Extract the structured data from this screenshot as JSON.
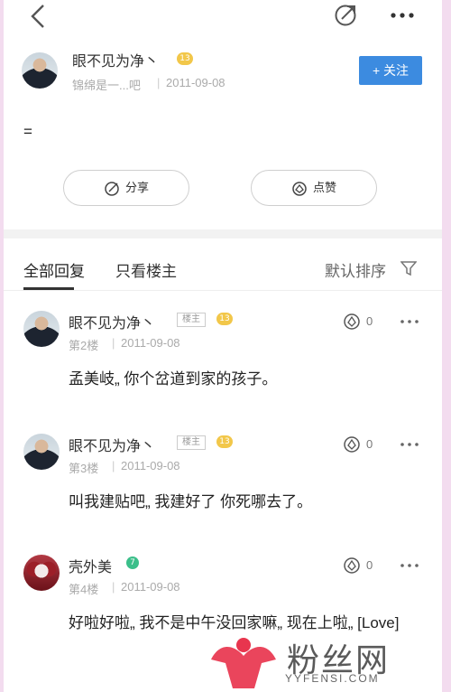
{
  "post": {
    "author": "眼不见为净丶",
    "badge_level": "13",
    "meta_signature": "锦绵是一...吧",
    "date": "2011-09-08",
    "follow_label": "+ 关注",
    "body": "=",
    "share_label": "分享",
    "like_label": "点赞"
  },
  "tabs": {
    "all_replies": "全部回复",
    "owner_only": "只看楼主",
    "sort_label": "默认排序"
  },
  "replies": [
    {
      "author": "眼不见为净丶",
      "owner_tag": "楼主",
      "badge_level": "13",
      "floor": "第2楼",
      "date": "2011-09-08",
      "likes": "0",
      "text": "孟美岐„ 你个岔道到家的孩子。"
    },
    {
      "author": "眼不见为净丶",
      "owner_tag": "楼主",
      "badge_level": "13",
      "floor": "第3楼",
      "date": "2011-09-08",
      "likes": "0",
      "text": "叫我建贴吧„ 我建好了 你死哪去了。"
    },
    {
      "author": "壳外美",
      "badge_level": "7",
      "floor": "第4楼",
      "date": "2011-09-08",
      "likes": "0",
      "text": "好啦好啦„ 我不是中午没回家嘛„ 现在上啦„ [Love]"
    }
  ],
  "watermark": {
    "brand": "粉丝网",
    "url": "YYFENSI.COM"
  }
}
